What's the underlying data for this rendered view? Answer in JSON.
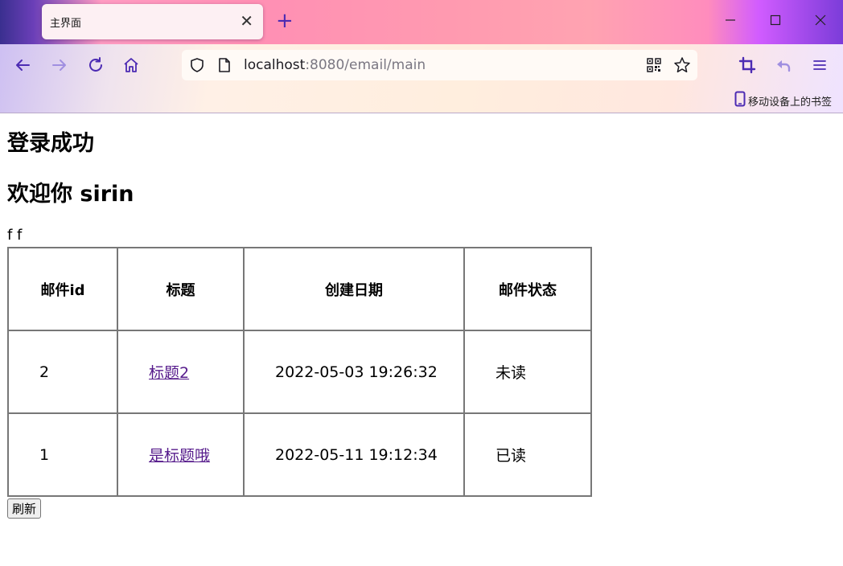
{
  "browser": {
    "tab_title": "主界面",
    "tab_close": "✕",
    "new_tab": "+",
    "url_host": "localhost",
    "url_rest": ":8080/email/main",
    "mobile_bookmarks": "移动设备上的书签",
    "accent_color": "#4c2bb3"
  },
  "page": {
    "login_heading": "登录成功",
    "welcome_heading": "欢迎你 sirin",
    "ff_text": "f f",
    "table": {
      "headers": [
        "邮件id",
        "标题",
        "创建日期",
        "邮件状态"
      ],
      "rows": [
        {
          "id": "2",
          "title": "标题2",
          "created": "2022-05-03 19:26:32",
          "status": "未读"
        },
        {
          "id": "1",
          "title": "是标题哦",
          "created": "2022-05-11 19:12:34",
          "status": "已读"
        }
      ]
    },
    "refresh_label": "刷新"
  }
}
